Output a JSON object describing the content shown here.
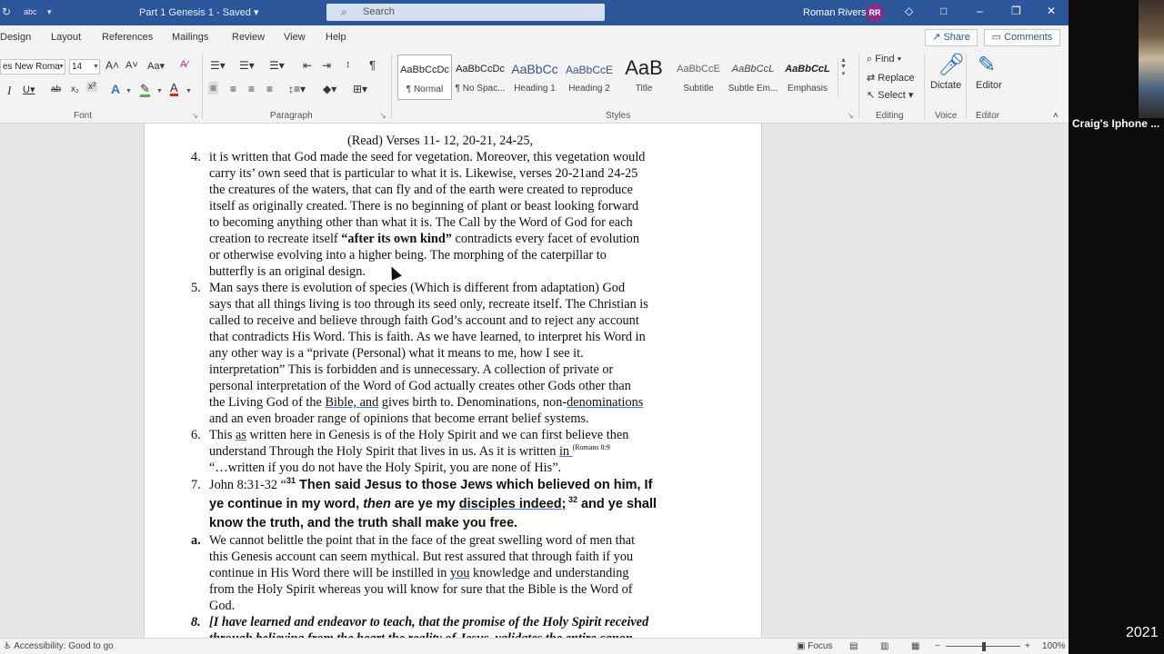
{
  "titlebar": {
    "doc_title": "Part 1 Genesis 1 - Saved ▾",
    "search_placeholder": "Search",
    "user_name": "Roman Rivers",
    "avatar_initials": "RR",
    "accent_color": "#2b579a"
  },
  "menu": {
    "items": [
      "Design",
      "Layout",
      "References",
      "Mailings",
      "Review",
      "View",
      "Help"
    ],
    "share": "Share",
    "comments": "Comments"
  },
  "ribbon": {
    "font_name": "es New Roma",
    "font_size": "14",
    "groups": [
      "Font",
      "Paragraph",
      "Styles",
      "Editing",
      "Voice",
      "Editor"
    ],
    "styles": [
      {
        "sample": "AaBbCcDc",
        "name": "¶ Normal"
      },
      {
        "sample": "AaBbCcDc",
        "name": "¶ No Spac..."
      },
      {
        "sample": "AaBbCc",
        "name": "Heading 1"
      },
      {
        "sample": "AaBbCcE",
        "name": "Heading 2"
      },
      {
        "sample": "AaB",
        "name": "Title"
      },
      {
        "sample": "AaBbCcE",
        "name": "Subtitle"
      },
      {
        "sample": "AaBbCcL",
        "name": "Subtle Em..."
      },
      {
        "sample": "AaBbCcL",
        "name": "Emphasis"
      }
    ],
    "editing": {
      "find": "Find",
      "replace": "Replace",
      "select": "Select"
    },
    "dictate": "Dictate",
    "editor": "Editor"
  },
  "document": {
    "heading": "(Read) Verses 11- 12, 20-21, 24-25,",
    "p4": {
      "num": "4.",
      "lines": [
        "it is written that God made the seed for vegetation. Moreover, this vegetation would",
        "carry its’ own seed that is particular to what it is. Likewise, verses 20-21and 24-25",
        "the creatures of the waters, that can fly and of the earth were created to reproduce",
        "itself as originally created. There is no beginning of plant or beast looking forward",
        "to becoming anything other than what it is. The Call by the Word of God for each"
      ],
      "l6_pre": "creation to recreate itself ",
      "l6_bold": "“after its own kind”",
      "l6_post": " contradicts every facet of evolution",
      "l7": "or otherwise evolving into a higher being. The morphing of the caterpillar to",
      "l8": "butterfly is an original design."
    },
    "p5": {
      "num": "5.",
      "lines": [
        "Man says there is evolution of species (Which is different from adaptation) God",
        "says that all things living is too through its seed only, recreate itself. The Christian is",
        "called to receive and believe through faith God’s account and to reject any account",
        "that contradicts His Word. This is faith. As we have learned, to interpret his Word in",
        "any other way is a “private (Personal) what it means to me, how I see it.",
        "interpretation” This is forbidden and is unnecessary. A collection of private or",
        "personal interpretation of the Word of God actually creates other Gods other than"
      ],
      "l8_pre": "the Living God of the ",
      "l8_u1": "Bible, and",
      "l8_mid": " gives birth to. Denominations, non-",
      "l8_u2": "denominations",
      "l9": "and an even broader range of opinions that become errant belief systems."
    },
    "p6": {
      "num": "6.",
      "l1_pre": "This ",
      "l1_u": "as",
      "l1_post": " written here in Genesis is of the Holy Spirit and we can first believe then",
      "l2_pre": "understand Through the Holy Spirit that lives in us. As it is written ",
      "l2_u": "in ",
      "l2_ref": "(Romans 8:9",
      "l3": "“…written if you do not have the Holy Spirit, you are none of His”."
    },
    "p7": {
      "num": "7.",
      "l1_ref": "John 8:31-32 “",
      "l1_sup": "31",
      "l1_bold": " Then said Jesus to those Jews which believed on him, If",
      "l2_a": "ye continue in my word, ",
      "l2_em": "then",
      "l2_b": " are ye my ",
      "l2_u": "disciples indeed;",
      "l2_sup": " 32",
      "l2_c": " and ye shall",
      "l3": "know the truth, and the truth shall make you free."
    },
    "pa": {
      "num": "a.",
      "l1": "We cannot belittle the point that in the face of the great swelling word of men that",
      "l2": "this Genesis account can seem mythical. But rest assured that through faith if you",
      "l3_pre": "continue in His Word there will be instilled in ",
      "l3_u": "you",
      "l3_post": " knowledge and understanding",
      "l4": "from the Holy Spirit whereas you will know for sure that the Bible is the Word of",
      "l5": "God."
    },
    "p8": {
      "num": "8.",
      "l1": "[I have learned and endeavor to teach, that the promise of the Holy Spirit received",
      "l2": "through believing from the heart the reality of Jesus, validates the entire canon"
    }
  },
  "statusbar": {
    "accessibility": "Accessibility: Good to go",
    "focus": "Focus",
    "zoom_minus": "−",
    "zoom_plus": "+",
    "zoom": "100%"
  },
  "side_panel": {
    "label": "Craig's Iphone ...",
    "year": "2021"
  }
}
